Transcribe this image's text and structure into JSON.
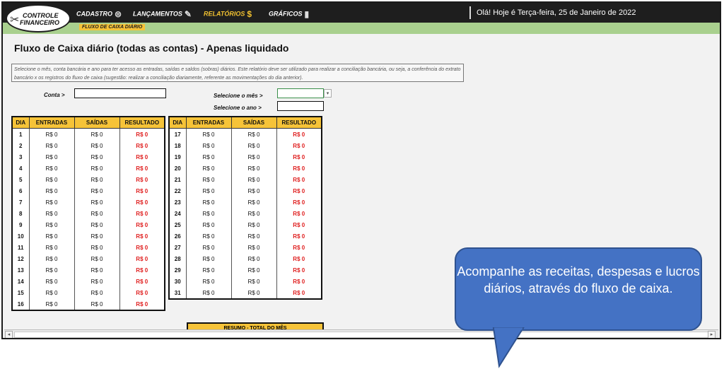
{
  "app": {
    "logo_line1": "CONTROLE",
    "logo_line2": "FINANCEIRO"
  },
  "nav": [
    {
      "label": "CADASTRO",
      "icon": "coins-icon"
    },
    {
      "label": "LANÇAMENTOS",
      "icon": "pencil-icon"
    },
    {
      "label": "RELATÓRIOS",
      "icon": "dollar-document-icon"
    },
    {
      "label": "GRÁFICOS",
      "icon": "bar-chart-icon"
    }
  ],
  "greeting": "Olá! Hoje é Terça-feira, 25 de Janeiro de 2022",
  "breadcrumb": "FLUXO DE CAIXA DIÁRIO",
  "page_title": "Fluxo de Caixa diário (todas as contas) - Apenas liquidado",
  "description": "Selecione o mês, conta bancária e ano para ter acesso as entradas, saídas e saldos (sobras) diários. Este relatório deve ser utilizado para realizar a conciliação bancária, ou seja, a conferência do extrato bancário x os registros do fluxo de caixa (sugestão: realizar a conciliação diariamente, referente as movimentações do dia anterior).",
  "filters": {
    "conta_label": "Conta >",
    "conta_value": "",
    "mes_label": "Selecione o mês >",
    "mes_value": "",
    "ano_label": "Selecione o ano >",
    "ano_value": ""
  },
  "table_headers": [
    "DIA",
    "ENTRADAS",
    "SAÍDAS",
    "RESULTADO"
  ],
  "table_left": [
    {
      "dia": "1",
      "entradas": "R$ 0",
      "saidas": "R$ 0",
      "resultado": "R$ 0"
    },
    {
      "dia": "2",
      "entradas": "R$ 0",
      "saidas": "R$ 0",
      "resultado": "R$ 0"
    },
    {
      "dia": "3",
      "entradas": "R$ 0",
      "saidas": "R$ 0",
      "resultado": "R$ 0"
    },
    {
      "dia": "4",
      "entradas": "R$ 0",
      "saidas": "R$ 0",
      "resultado": "R$ 0"
    },
    {
      "dia": "5",
      "entradas": "R$ 0",
      "saidas": "R$ 0",
      "resultado": "R$ 0"
    },
    {
      "dia": "6",
      "entradas": "R$ 0",
      "saidas": "R$ 0",
      "resultado": "R$ 0"
    },
    {
      "dia": "7",
      "entradas": "R$ 0",
      "saidas": "R$ 0",
      "resultado": "R$ 0"
    },
    {
      "dia": "8",
      "entradas": "R$ 0",
      "saidas": "R$ 0",
      "resultado": "R$ 0"
    },
    {
      "dia": "9",
      "entradas": "R$ 0",
      "saidas": "R$ 0",
      "resultado": "R$ 0"
    },
    {
      "dia": "10",
      "entradas": "R$ 0",
      "saidas": "R$ 0",
      "resultado": "R$ 0"
    },
    {
      "dia": "11",
      "entradas": "R$ 0",
      "saidas": "R$ 0",
      "resultado": "R$ 0"
    },
    {
      "dia": "12",
      "entradas": "R$ 0",
      "saidas": "R$ 0",
      "resultado": "R$ 0"
    },
    {
      "dia": "13",
      "entradas": "R$ 0",
      "saidas": "R$ 0",
      "resultado": "R$ 0"
    },
    {
      "dia": "14",
      "entradas": "R$ 0",
      "saidas": "R$ 0",
      "resultado": "R$ 0"
    },
    {
      "dia": "15",
      "entradas": "R$ 0",
      "saidas": "R$ 0",
      "resultado": "R$ 0"
    },
    {
      "dia": "16",
      "entradas": "R$ 0",
      "saidas": "R$ 0",
      "resultado": "R$ 0"
    }
  ],
  "table_right": [
    {
      "dia": "17",
      "entradas": "R$ 0",
      "saidas": "R$ 0",
      "resultado": "R$ 0"
    },
    {
      "dia": "18",
      "entradas": "R$ 0",
      "saidas": "R$ 0",
      "resultado": "R$ 0"
    },
    {
      "dia": "19",
      "entradas": "R$ 0",
      "saidas": "R$ 0",
      "resultado": "R$ 0"
    },
    {
      "dia": "20",
      "entradas": "R$ 0",
      "saidas": "R$ 0",
      "resultado": "R$ 0"
    },
    {
      "dia": "21",
      "entradas": "R$ 0",
      "saidas": "R$ 0",
      "resultado": "R$ 0"
    },
    {
      "dia": "22",
      "entradas": "R$ 0",
      "saidas": "R$ 0",
      "resultado": "R$ 0"
    },
    {
      "dia": "23",
      "entradas": "R$ 0",
      "saidas": "R$ 0",
      "resultado": "R$ 0"
    },
    {
      "dia": "24",
      "entradas": "R$ 0",
      "saidas": "R$ 0",
      "resultado": "R$ 0"
    },
    {
      "dia": "25",
      "entradas": "R$ 0",
      "saidas": "R$ 0",
      "resultado": "R$ 0"
    },
    {
      "dia": "26",
      "entradas": "R$ 0",
      "saidas": "R$ 0",
      "resultado": "R$ 0"
    },
    {
      "dia": "27",
      "entradas": "R$ 0",
      "saidas": "R$ 0",
      "resultado": "R$ 0"
    },
    {
      "dia": "28",
      "entradas": "R$ 0",
      "saidas": "R$ 0",
      "resultado": "R$ 0"
    },
    {
      "dia": "29",
      "entradas": "R$ 0",
      "saidas": "R$ 0",
      "resultado": "R$ 0"
    },
    {
      "dia": "30",
      "entradas": "R$ 0",
      "saidas": "R$ 0",
      "resultado": "R$ 0"
    },
    {
      "dia": "31",
      "entradas": "R$ 0",
      "saidas": "R$ 0",
      "resultado": "R$ 0"
    }
  ],
  "resumo_label": "RESUMO - TOTAL DO MÊS",
  "callout_text": "Acompanhe as receitas, despesas e lucros diários, através do fluxo de caixa.",
  "colors": {
    "topbar": "#1e1e1e",
    "subbar": "#a9d08e",
    "accent_yellow": "#f6c338",
    "active_nav": "#f2c230",
    "negative_red": "#e02020",
    "callout_blue": "#4472c4"
  }
}
